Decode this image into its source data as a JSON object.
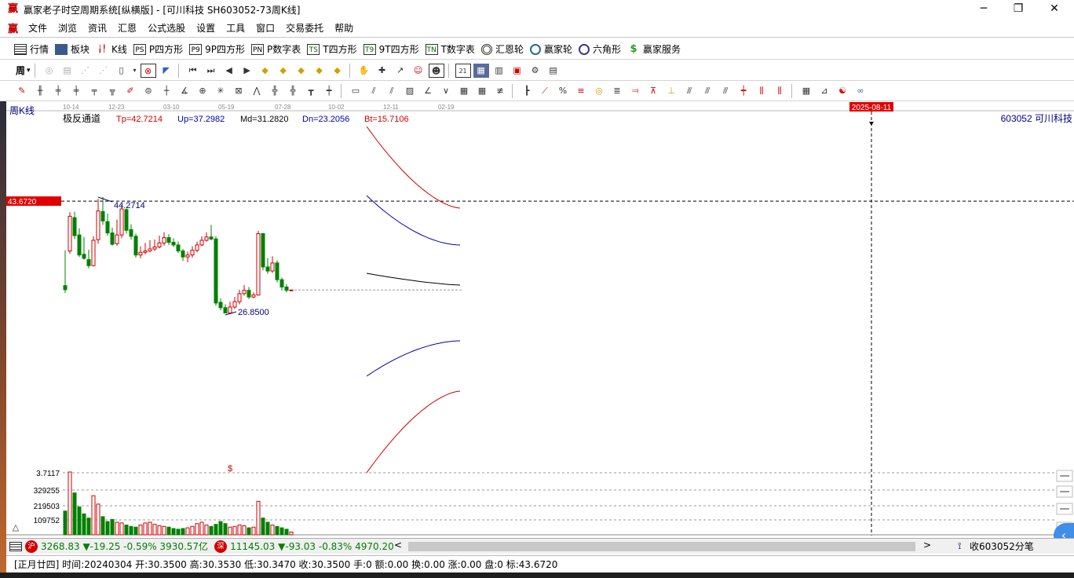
{
  "window": {
    "title": "赢家老子时空周期系统[纵横版] - [可川科技  SH603052-73周K线]",
    "logo_text": "赢",
    "minimize": "─",
    "maximize": "❐",
    "close": "✕"
  },
  "menu": {
    "items": [
      "文件",
      "浏览",
      "资讯",
      "汇恩",
      "公式选股",
      "设置",
      "工具",
      "窗口",
      "交易委托",
      "帮助"
    ],
    "mdi_minimize": "_",
    "mdi_restore": "❐",
    "mdi_close": "✕"
  },
  "toolbar1": {
    "items": [
      {
        "icon": "grid-icon",
        "label": "行情"
      },
      {
        "icon": "blocks-icon",
        "label": "板块"
      },
      {
        "icon": "candle-icon",
        "label": "K线"
      },
      {
        "icon": "ps-icon",
        "icon_text": "PS",
        "label": "P四方形"
      },
      {
        "icon": "p9-icon",
        "icon_text": "P9",
        "label": "9P四方形"
      },
      {
        "icon": "pn-icon",
        "icon_text": "PN",
        "label": "P数字表"
      },
      {
        "icon": "ts-icon",
        "icon_text": "TS",
        "label": "T四方形"
      },
      {
        "icon": "t9-icon",
        "icon_text": "T9",
        "label": "9T四方形"
      },
      {
        "icon": "tn-icon",
        "icon_text": "TN",
        "label": "T数字表"
      },
      {
        "icon": "target-icon",
        "label": "汇恩轮"
      },
      {
        "icon": "wheel-icon",
        "label": "赢家轮"
      },
      {
        "icon": "hexagon-icon",
        "label": "六角形"
      },
      {
        "icon": "dollar-icon",
        "icon_text": "$",
        "label": "赢家服务"
      }
    ]
  },
  "toolbar2": {
    "period_label": "周",
    "dropdown_arrow": "▾"
  },
  "chart": {
    "period_label": "周K线",
    "indicator": {
      "name": "极反通道",
      "tp": "Tp=42.7214",
      "up": "Up=37.2982",
      "md": "Md=31.2820",
      "dn": "Dn=23.2056",
      "bt": "Bt=15.7106"
    },
    "stock_label": "603052 可川科技",
    "price_marker": "43.6720",
    "high_label": "44.2714",
    "low_label": "26.8500",
    "date_marker": "2025-08-11",
    "top_date_ticks": [
      "10-14",
      "12-23",
      "03-10",
      "05-19",
      "07-28",
      "10-02",
      "12-11",
      "02-19"
    ],
    "volume_axis": [
      "3.7117",
      "329255",
      "219503",
      "109752"
    ],
    "volume_marker": "$",
    "triangle_button": "△",
    "colors": {
      "up": "#d00000",
      "down": "#008000",
      "channel_outer": "#d00000",
      "channel_inner": "#0000b0",
      "channel_mid": "#000000",
      "marker_bg": "#e00000",
      "label_blue": "#000080"
    }
  },
  "chart_data": {
    "type": "candlestick",
    "title": "",
    "xlabel": "",
    "ylabel": "",
    "candles": [
      [
        31.0,
        30.4,
        36.3,
        29.9
      ],
      [
        36.2,
        41.4,
        42.0,
        35.8
      ],
      [
        41.2,
        38.5,
        42.1,
        38.0
      ],
      [
        38.6,
        35.6,
        39.6,
        35.3
      ],
      [
        35.7,
        35.1,
        38.3,
        34.9
      ],
      [
        34.9,
        34.0,
        36.4,
        33.6
      ],
      [
        34.0,
        37.8,
        38.4,
        33.9
      ],
      [
        37.9,
        42.2,
        44.0,
        37.3
      ],
      [
        42.1,
        40.7,
        44.3,
        40.1
      ],
      [
        40.6,
        38.9,
        41.8,
        38.5
      ],
      [
        38.9,
        37.2,
        39.7,
        37.0
      ],
      [
        37.3,
        38.6,
        40.9,
        37.0
      ],
      [
        38.6,
        42.5,
        43.1,
        38.1
      ],
      [
        42.4,
        39.3,
        42.6,
        38.8
      ],
      [
        39.4,
        38.4,
        40.2,
        37.9
      ],
      [
        38.4,
        35.6,
        38.8,
        35.2
      ],
      [
        35.6,
        36.0,
        36.9,
        35.1
      ],
      [
        36.0,
        36.2,
        37.4,
        35.7
      ],
      [
        36.2,
        36.5,
        37.8,
        36.0
      ],
      [
        36.5,
        36.8,
        37.9,
        36.2
      ],
      [
        36.8,
        37.4,
        38.5,
        36.6
      ],
      [
        37.4,
        38.2,
        39.0,
        37.0
      ],
      [
        38.2,
        37.5,
        38.7,
        37.1
      ],
      [
        37.5,
        37.1,
        38.1,
        36.8
      ],
      [
        37.1,
        36.2,
        37.6,
        35.9
      ],
      [
        36.2,
        35.3,
        36.5,
        34.7
      ],
      [
        35.3,
        35.6,
        36.1,
        34.5
      ],
      [
        35.6,
        36.3,
        36.9,
        35.2
      ],
      [
        36.3,
        37.1,
        37.6,
        36.0
      ],
      [
        37.1,
        37.8,
        38.4,
        36.9
      ],
      [
        37.8,
        38.3,
        39.0,
        37.6
      ],
      [
        38.3,
        38.0,
        40.1,
        37.8
      ],
      [
        38.0,
        28.4,
        38.4,
        28.0
      ],
      [
        28.5,
        27.7,
        29.1,
        27.3
      ],
      [
        27.7,
        26.9,
        28.2,
        26.9
      ],
      [
        26.9,
        27.8,
        28.6,
        26.9
      ],
      [
        27.8,
        28.6,
        29.3,
        27.5
      ],
      [
        28.6,
        29.8,
        30.4,
        28.2
      ],
      [
        29.8,
        30.3,
        31.1,
        29.5
      ],
      [
        30.3,
        29.3,
        30.8,
        29.0
      ],
      [
        29.3,
        29.6,
        30.0,
        29.1
      ],
      [
        29.6,
        38.8,
        39.2,
        29.5
      ],
      [
        38.8,
        33.8,
        38.9,
        33.3
      ],
      [
        33.8,
        33.2,
        35.1,
        32.8
      ],
      [
        33.2,
        34.4,
        35.4,
        32.9
      ],
      [
        34.4,
        31.9,
        34.8,
        31.5
      ],
      [
        31.9,
        30.8,
        32.2,
        30.3
      ],
      [
        30.8,
        30.3,
        31.2,
        30.0
      ],
      [
        30.35,
        30.35,
        30.353,
        30.347
      ]
    ],
    "volume_axis": [
      3.7117,
      329255,
      219503,
      109752
    ],
    "volume": [
      170000,
      450000,
      300000,
      200000,
      150000,
      120000,
      280000,
      220000,
      130000,
      95000,
      110000,
      90000,
      85000,
      70000,
      60000,
      55000,
      70000,
      85000,
      90000,
      75000,
      65000,
      60000,
      55000,
      45000,
      40000,
      45000,
      50000,
      60000,
      80000,
      90000,
      70000,
      60000,
      75000,
      95000,
      80000,
      55000,
      60000,
      70000,
      65000,
      50000,
      55000,
      240000,
      120000,
      90000,
      70000,
      60000,
      50000,
      40000,
      20000
    ],
    "channel": {
      "tp": 42.7214,
      "up": 37.2982,
      "md": 31.282,
      "dn": 23.2056,
      "bt": 15.7106
    },
    "reference_price": 43.672,
    "high": 44.2714,
    "low": 26.85
  },
  "status1": {
    "index1_icon": "沪",
    "index1": "3268.83 ▼-19.25 -0.59% 3930.57亿",
    "index2_icon": "深",
    "index2": "11145.03 ▼-93.03 -0.83% 4970.20",
    "scroll_left": "<",
    "scroll_right": ">",
    "right_text": "收603052分笔"
  },
  "status2": {
    "text": "[正月廿四] 时间:20240304 开:30.3500 高:30.3530 低:30.3470 收:30.3500 手:0 额:0.00 换:0.00 涨:0.00 盘:0 标:43.6720"
  },
  "side_button": "‹"
}
